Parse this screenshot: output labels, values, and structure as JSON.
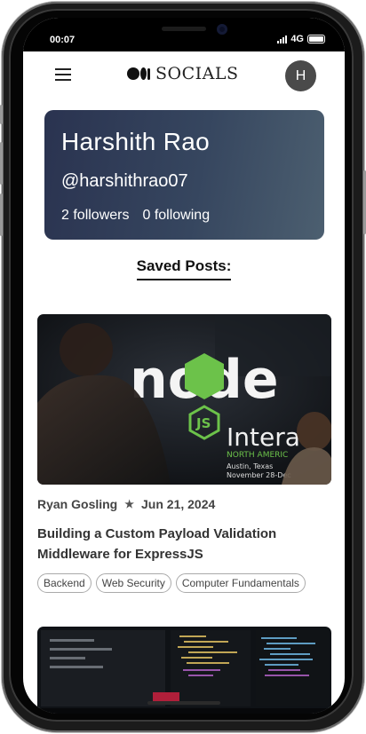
{
  "status_bar": {
    "time": "00:07",
    "network": "4G",
    "battery_level": 1.0
  },
  "header": {
    "logo_text": "SOCIALS",
    "avatar_initial": "H"
  },
  "profile": {
    "name": "Harshith Rao",
    "handle": "@harshithrao07",
    "followers": "2 followers",
    "following": "0 following"
  },
  "saved_posts_title": "Saved Posts:",
  "posts": [
    {
      "author": "Ryan Gosling",
      "separator": "★",
      "date": "Jun 21, 2024",
      "title": "Building a Custom Payload Validation Middleware for ExpressJS",
      "tags": [
        "Backend",
        "Web Security",
        "Computer Fundamentals"
      ],
      "image_text": {
        "brand": "node",
        "badge": "JS",
        "event": "Intera",
        "region": "NORTH AMERIC",
        "city": "Austin, Texas",
        "dates": "November 28-Dec"
      }
    }
  ],
  "icons": {
    "menu": "hamburger-menu-icon",
    "logo": "medium-logo-icon",
    "signal": "signal-icon",
    "battery": "battery-icon"
  },
  "colors": {
    "card_gradient_start": "#2a3350",
    "card_gradient_end": "#4c5f70",
    "avatar_bg": "#4a4a4a",
    "node_green": "#6cc24a"
  }
}
